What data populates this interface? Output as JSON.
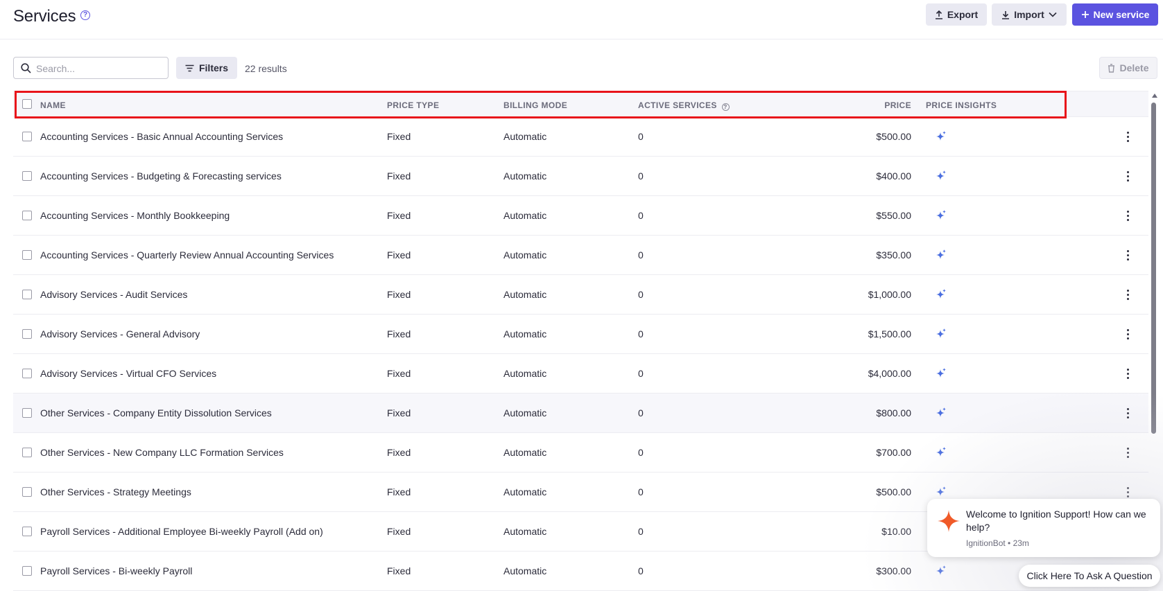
{
  "header": {
    "title": "Services",
    "export_label": "Export",
    "import_label": "Import",
    "new_service_label": "New service"
  },
  "toolbar": {
    "search_placeholder": "Search...",
    "filters_label": "Filters",
    "results_text": "22 results",
    "delete_label": "Delete"
  },
  "table": {
    "columns": {
      "name": "NAME",
      "price_type": "PRICE TYPE",
      "billing_mode": "BILLING MODE",
      "active_services": "ACTIVE SERVICES",
      "price": "PRICE",
      "price_insights": "PRICE INSIGHTS"
    },
    "rows": [
      {
        "name": "Accounting Services - Basic Annual Accounting Services",
        "price_type": "Fixed",
        "billing_mode": "Automatic",
        "active_services": "0",
        "price": "$500.00"
      },
      {
        "name": "Accounting Services - Budgeting & Forecasting services",
        "price_type": "Fixed",
        "billing_mode": "Automatic",
        "active_services": "0",
        "price": "$400.00"
      },
      {
        "name": "Accounting Services - Monthly Bookkeeping",
        "price_type": "Fixed",
        "billing_mode": "Automatic",
        "active_services": "0",
        "price": "$550.00"
      },
      {
        "name": "Accounting Services - Quarterly Review Annual Accounting Services",
        "price_type": "Fixed",
        "billing_mode": "Automatic",
        "active_services": "0",
        "price": "$350.00"
      },
      {
        "name": "Advisory Services - Audit Services",
        "price_type": "Fixed",
        "billing_mode": "Automatic",
        "active_services": "0",
        "price": "$1,000.00"
      },
      {
        "name": "Advisory Services - General Advisory",
        "price_type": "Fixed",
        "billing_mode": "Automatic",
        "active_services": "0",
        "price": "$1,500.00"
      },
      {
        "name": "Advisory Services - Virtual CFO Services",
        "price_type": "Fixed",
        "billing_mode": "Automatic",
        "active_services": "0",
        "price": "$4,000.00"
      },
      {
        "name": "Other Services - Company Entity Dissolution Services",
        "price_type": "Fixed",
        "billing_mode": "Automatic",
        "active_services": "0",
        "price": "$800.00"
      },
      {
        "name": "Other Services - New Company LLC Formation Services",
        "price_type": "Fixed",
        "billing_mode": "Automatic",
        "active_services": "0",
        "price": "$700.00"
      },
      {
        "name": "Other Services - Strategy Meetings",
        "price_type": "Fixed",
        "billing_mode": "Automatic",
        "active_services": "0",
        "price": "$500.00"
      },
      {
        "name": "Payroll Services - Additional Employee Bi-weekly Payroll (Add on)",
        "price_type": "Fixed",
        "billing_mode": "Automatic",
        "active_services": "0",
        "price": "$10.00"
      },
      {
        "name": "Payroll Services - Bi-weekly Payroll",
        "price_type": "Fixed",
        "billing_mode": "Automatic",
        "active_services": "0",
        "price": "$300.00"
      }
    ]
  },
  "chat": {
    "message": "Welcome to Ignition Support! How can we help?",
    "sender_meta": "IgnitionBot • 23m",
    "ask_label": "Click Here To Ask A Question"
  },
  "colors": {
    "accent": "#5b53e0",
    "highlight_border": "#e8141a",
    "insight_icon": "#4a6ee0",
    "chat_star": "#f05a28"
  },
  "icons": {
    "help": "help-circle-icon",
    "export": "upload-icon",
    "import": "download-icon",
    "new": "plus-icon",
    "search": "search-icon",
    "filters": "filter-icon",
    "delete": "trash-icon",
    "insight": "sparkle-icon",
    "row_menu": "kebab-menu-icon"
  }
}
